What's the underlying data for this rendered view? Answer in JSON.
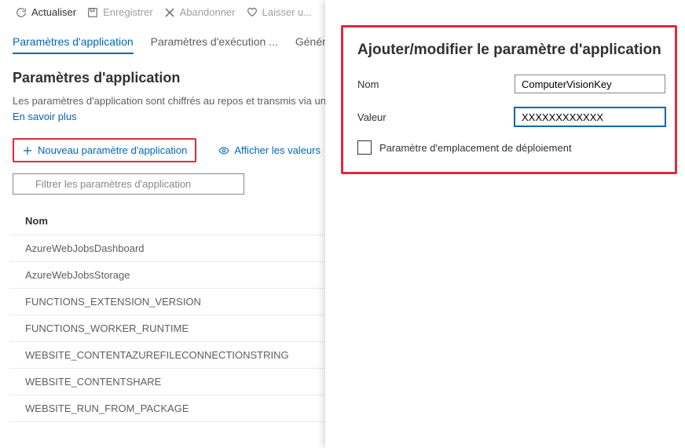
{
  "toolbar": {
    "refresh": "Actualiser",
    "save": "Enregistrer",
    "discard": "Abandonner",
    "favorite": "Laisser u..."
  },
  "tabs": {
    "app_settings": "Paramètres d'application",
    "exec_params": "Paramètres d'exécution ...",
    "general": "Génér..."
  },
  "section": {
    "title": "Paramètres d'application",
    "description": "Les paramètres d'application sont chiffrés au repos et transmis via un",
    "learn_more": "En savoir plus"
  },
  "actions": {
    "new_param": "Nouveau paramètre d'application",
    "show_values": "Afficher les valeurs"
  },
  "filter": {
    "placeholder": "Filtrer les paramètres d'application"
  },
  "table": {
    "header_name": "Nom",
    "rows": [
      "AzureWebJobsDashboard",
      "AzureWebJobsStorage",
      "FUNCTIONS_EXTENSION_VERSION",
      "FUNCTIONS_WORKER_RUNTIME",
      "WEBSITE_CONTENTAZUREFILECONNECTIONSTRING",
      "WEBSITE_CONTENTSHARE",
      "WEBSITE_RUN_FROM_PACKAGE"
    ]
  },
  "panel": {
    "title": "Ajouter/modifier le paramètre d'application",
    "name_label": "Nom",
    "name_value": "ComputerVisionKey",
    "value_label": "Valeur",
    "value_value": "XXXXXXXXXXXX",
    "deploy_slot": "Paramètre d'emplacement de déploiement"
  }
}
